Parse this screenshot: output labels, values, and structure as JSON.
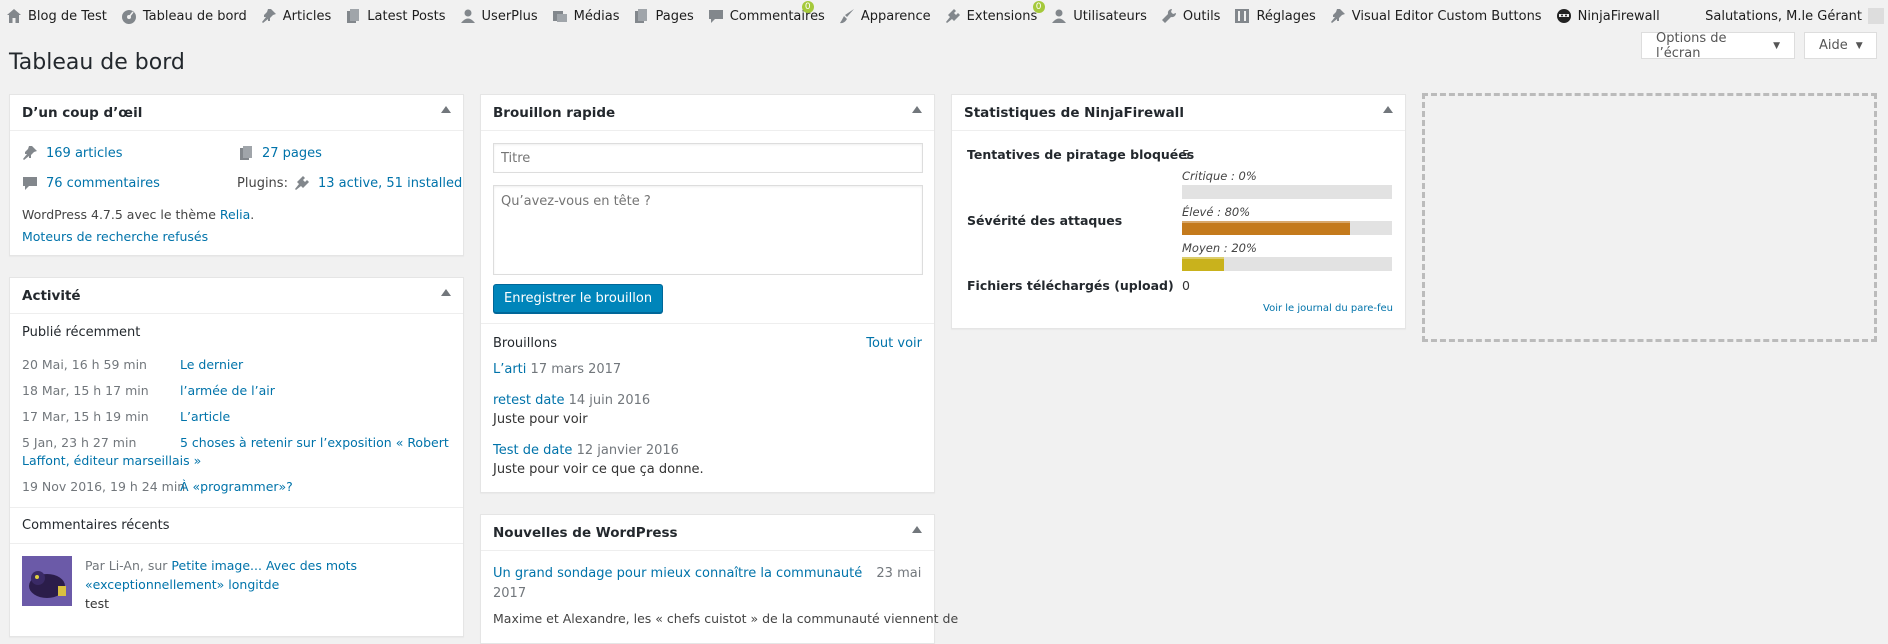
{
  "adminbar": {
    "site": "Blog de Test",
    "dashboard": "Tableau de bord",
    "posts": "Articles",
    "latest": "Latest Posts",
    "userplus": "UserPlus",
    "media": "Médias",
    "pages": "Pages",
    "comments": "Commentaires",
    "comments_badge": "0",
    "appearance": "Apparence",
    "plugins": "Extensions",
    "plugins_badge": "0",
    "users": "Utilisateurs",
    "tools": "Outils",
    "settings": "Réglages",
    "vecb": "Visual Editor Custom Buttons",
    "ninja": "NinjaFirewall",
    "greeting": "Salutations, M.le Gérant"
  },
  "page": {
    "title": "Tableau de bord",
    "screen_options": "Options de l’écran",
    "help": "Aide"
  },
  "glance": {
    "title": "D’un coup d’œil",
    "articles": "169 articles",
    "pages": "27 pages",
    "comments": "76 commentaires",
    "plugins_label": "Plugins:",
    "plugins_value": "13 active, 51 installed",
    "wp_version": "WordPress 4.7.5 avec le thème",
    "theme": "Relia",
    "theme_suffix": ".",
    "search_engines": "Moteurs de recherche refusés"
  },
  "activity": {
    "title": "Activité",
    "recent_published": "Publié récemment",
    "posts": [
      {
        "date": "20 Mai, 16 h 59 min",
        "title": "Le dernier"
      },
      {
        "date": "18 Mar, 15 h 17 min",
        "title": "l’armée de l’air"
      },
      {
        "date": "17 Mar, 15 h 19 min",
        "title": "L’article"
      },
      {
        "date": "5 Jan, 23 h 27 min",
        "title": "5 choses à retenir sur l’exposition « Robert",
        "title_cont": "Laffont, éditeur marseillais »"
      },
      {
        "date": "19 Nov 2016, 19 h 24 min",
        "title": "À «programmer»?"
      }
    ],
    "recent_comments": "Commentaires récents",
    "comment_by": "Par Li-An, sur",
    "comment_post": "Petite image... Avec des mots",
    "comment_post_cont": "«exceptionnellement» longitde",
    "comment_text": "test"
  },
  "quickdraft": {
    "title": "Brouillon rapide",
    "title_placeholder": "Titre",
    "content_placeholder": "Qu’avez-vous en tête ?",
    "save_button": "Enregistrer le brouillon",
    "drafts_heading": "Brouillons",
    "view_all": "Tout voir",
    "drafts": [
      {
        "title": "L’arti",
        "date": "17 mars 2017",
        "excerpt": ""
      },
      {
        "title": "retest date",
        "date": "14 juin 2016",
        "excerpt": "Juste pour voir"
      },
      {
        "title": "Test de date",
        "date": "12 janvier 2016",
        "excerpt": "Juste pour voir ce que ça donne."
      }
    ]
  },
  "news": {
    "title": "Nouvelles de WordPress",
    "item_title": "Un grand sondage pour mieux connaître la communauté",
    "item_date": "23 mai",
    "item_year": "2017",
    "item_excerpt": "Maxime et Alexandre, les « chefs cuistot » de la communauté viennent de"
  },
  "ninjafirewall": {
    "title": "Statistiques de NinjaFirewall",
    "blocked_label": "Tentatives de piratage bloquées",
    "blocked_value": "5",
    "critical_label": "Critique : 0%",
    "critical_pct": 0,
    "severity_label": "Sévérité des attaques",
    "high_label": "Élevé : 80%",
    "high_pct": 80,
    "medium_label": "Moyen : 20%",
    "medium_pct": 20,
    "uploads_label": "Fichiers téléchargés (upload)",
    "uploads_value": "0",
    "log_link": "Voir le journal du pare-feu",
    "colors": {
      "high": "#c47a1c",
      "medium": "#c9b21c",
      "track": "#e2e2e2"
    }
  },
  "icons": [
    "wordpress-icon",
    "dashboard-icon",
    "pin-icon",
    "page-icon",
    "user-icon",
    "media-icon",
    "comment-icon",
    "brush-icon",
    "plugin-icon",
    "wrench-icon",
    "settings-icon",
    "ninja-icon"
  ]
}
